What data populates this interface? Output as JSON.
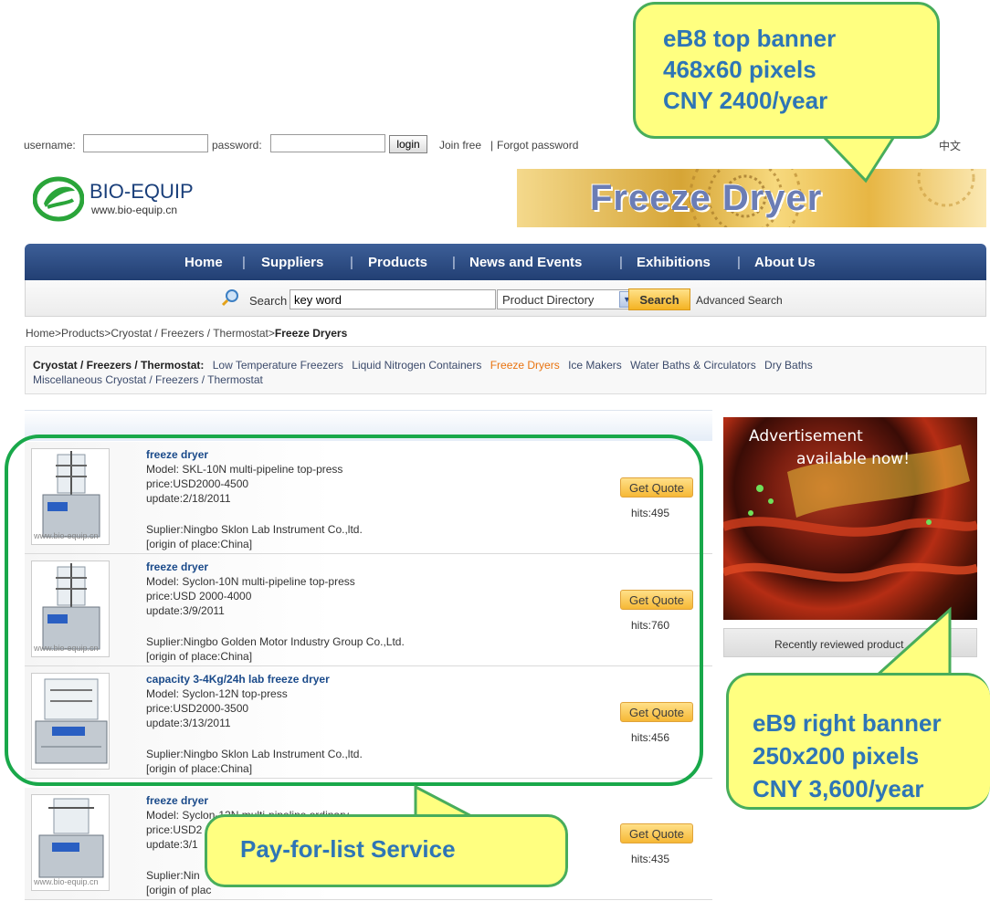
{
  "login": {
    "username_label": "username:",
    "password_label": "password:",
    "username_value": "",
    "password_value": "",
    "login_button": "login",
    "join_free": "Join free",
    "separator": "|",
    "forgot_password": "Forgot password",
    "language": "中文"
  },
  "header": {
    "brand": "BIO-EQUIP",
    "url": "www.bio-equip.cn",
    "banner_text": "Freeze Dryer"
  },
  "nav": {
    "items": [
      "Home",
      "Suppliers",
      "Products",
      "News and Events",
      "Exhibitions",
      "About Us"
    ],
    "separator": "|"
  },
  "search": {
    "label": "Search",
    "value": "key word",
    "directory_selected": "Product Directory",
    "button": "Search",
    "advanced": "Advanced Search"
  },
  "breadcrumb": {
    "path": "Home>Products>Cryostat / Freezers / Thermostat>",
    "current": "Freeze Dryers"
  },
  "categories": {
    "heading": "Cryostat / Freezers / Thermostat:",
    "items": [
      "Low Temperature Freezers",
      "Liquid Nitrogen Containers",
      "Freeze Dryers",
      "Ice Makers",
      "Water Baths & Circulators",
      "Dry Baths"
    ],
    "active": "Freeze Dryers",
    "second_line": "Miscellaneous Cryostat / Freezers / Thermostat"
  },
  "products": [
    {
      "name": "freeze dryer",
      "model": "Model: SKL-10N multi-pipeline top-press",
      "price": "price:USD2000-4500",
      "update": "update:2/18/2011",
      "supplier": "Suplier:Ningbo Sklon Lab Instrument Co.,ltd.",
      "origin": "[origin of place:China]",
      "quote": "Get Quote",
      "hits": "hits:495",
      "watermark": "www.bio-equip.cn"
    },
    {
      "name": "freeze dryer",
      "model": "Model: Syclon-10N multi-pipeline top-press",
      "price": "price:USD 2000-4000",
      "update": "update:3/9/2011",
      "supplier": "Suplier:Ningbo Golden Motor Industry Group Co.,Ltd.",
      "origin": "[origin of place:China]",
      "quote": "Get Quote",
      "hits": "hits:760",
      "watermark": "www.bio-equip.cn"
    },
    {
      "name": "capacity 3-4Kg/24h lab freeze dryer",
      "model": "Model: Syclon-12N top-press",
      "price": "price:USD2000-3500",
      "update": "update:3/13/2011",
      "supplier": "Suplier:Ningbo Sklon Lab Instrument Co.,ltd.",
      "origin": "[origin of place:China]",
      "quote": "Get Quote",
      "hits": "hits:456",
      "watermark": ""
    },
    {
      "name": "freeze dryer",
      "model": "Model: Syclon-12N multi-pipeline ordinary",
      "price": "price:USD2",
      "update": "update:3/1",
      "supplier": "Suplier:Nin",
      "origin": "[origin of plac",
      "quote": "Get Quote",
      "hits": "hits:435",
      "watermark": "www.bio-equip.cn"
    }
  ],
  "right_ad": {
    "line1": "Advertisement",
    "line2": "available now!",
    "recent": "Recently reviewed product"
  },
  "callouts": {
    "top": {
      "line1": "eB8 top banner",
      "line2": "468x60 pixels",
      "line3": "CNY 2400/year"
    },
    "right": {
      "line1": "eB9 right banner",
      "line2": "250x200 pixels",
      "line3": "CNY 3,600/year"
    },
    "list": {
      "text": "Pay-for-list Service"
    }
  },
  "colors": {
    "nav_bg": "#223f73",
    "accent_orange": "#f4b323",
    "callout_fill": "#ffff80",
    "callout_border": "#48ad5b",
    "callout_text": "#2e75b6",
    "highlight_ring": "#19a84a"
  }
}
